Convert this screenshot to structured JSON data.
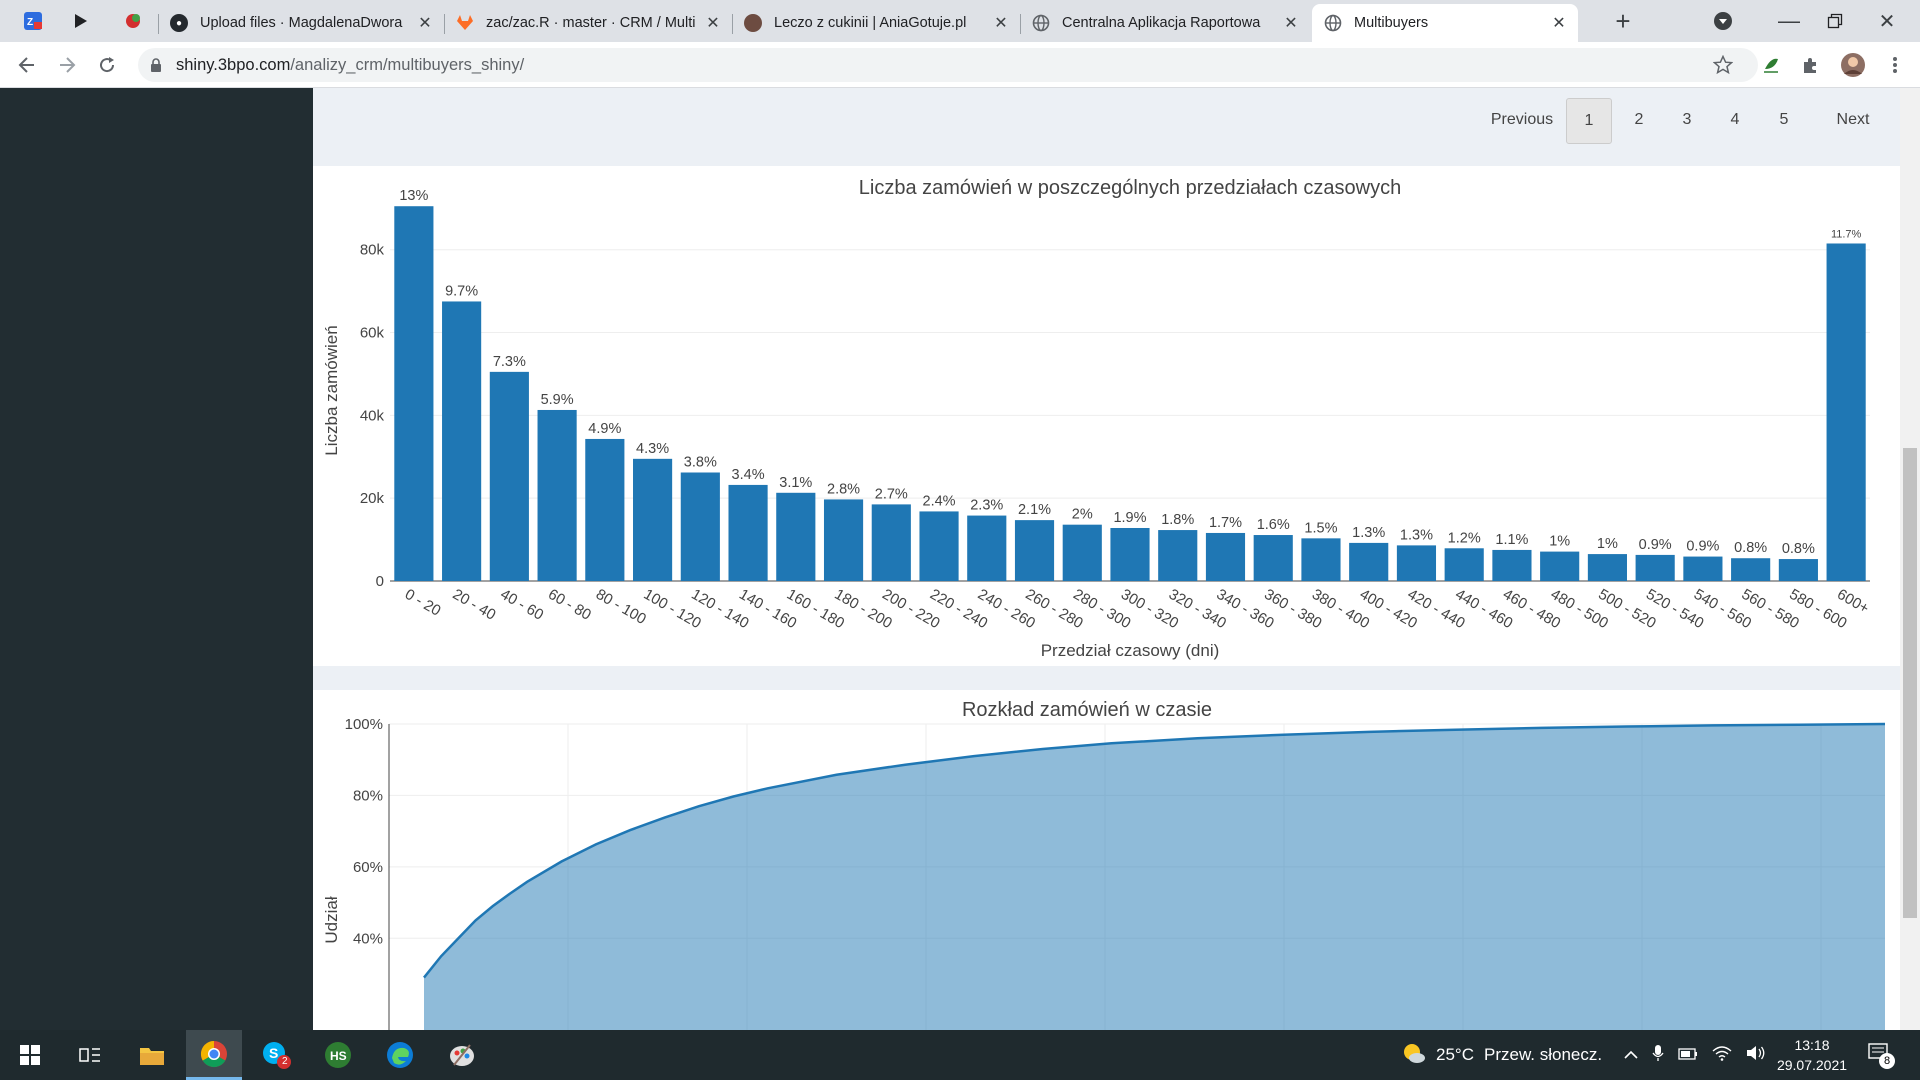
{
  "browser": {
    "tabs": [
      {
        "title": "Upload files · MagdalenaDwora",
        "favicon": "github-icon"
      },
      {
        "title": "zac/zac.R · master · CRM / Multi",
        "favicon": "gitlab-icon"
      },
      {
        "title": "Leczo z cukinii | AniaGotuje.pl",
        "favicon": "avatar-icon"
      },
      {
        "title": "Centralna Aplikacja Raportowa",
        "favicon": "globe-icon"
      },
      {
        "title": "Multibuyers",
        "favicon": "globe-icon",
        "active": true
      }
    ],
    "url_host": "shiny.3bpo.com",
    "url_path": "/analizy_crm/multibuyers_shiny/"
  },
  "pager": {
    "previous": "Previous",
    "pages": [
      "1",
      "2",
      "3",
      "4",
      "5"
    ],
    "current": "1",
    "next": "Next"
  },
  "chart_data": [
    {
      "type": "bar",
      "title": "Liczba zamówień w poszczególnych przedziałach czasowych",
      "xlabel": "Przedział czasowy (dni)",
      "ylabel": "Liczba zamówień",
      "ylim": [
        0,
        92000
      ],
      "yticks": [
        "0",
        "20k",
        "40k",
        "60k",
        "80k"
      ],
      "ytick_values": [
        0,
        20000,
        40000,
        60000,
        80000
      ],
      "grid": true,
      "color": "#1f77b4",
      "categories": [
        "0 - 20",
        "20 - 40",
        "40 - 60",
        "60 - 80",
        "80 - 100",
        "100 - 120",
        "120 - 140",
        "140 - 160",
        "160 - 180",
        "180 - 200",
        "200 - 220",
        "220 - 240",
        "240 - 260",
        "260 - 280",
        "280 - 300",
        "300 - 320",
        "320 - 340",
        "340 - 360",
        "360 - 380",
        "380 - 400",
        "400 - 420",
        "420 - 440",
        "440 - 460",
        "460 - 480",
        "480 - 500",
        "500 - 520",
        "520 - 540",
        "540 - 560",
        "560 - 580",
        "580 - 600",
        "600+"
      ],
      "values": [
        90500,
        67500,
        50500,
        41300,
        34300,
        29500,
        26200,
        23200,
        21300,
        19700,
        18500,
        16800,
        15800,
        14700,
        13600,
        12800,
        12300,
        11600,
        11100,
        10300,
        9200,
        8600,
        7900,
        7500,
        7100,
        6500,
        6300,
        5900,
        5500,
        5300,
        81500
      ],
      "labels": [
        "13%",
        "9.7%",
        "7.3%",
        "5.9%",
        "4.9%",
        "4.3%",
        "3.8%",
        "3.4%",
        "3.1%",
        "2.8%",
        "2.7%",
        "2.4%",
        "2.3%",
        "2.1%",
        "2%",
        "1.9%",
        "1.8%",
        "1.7%",
        "1.6%",
        "1.5%",
        "1.3%",
        "1.3%",
        "1.2%",
        "1.1%",
        "1%",
        "1%",
        "0.9%",
        "0.9%",
        "0.8%",
        "0.8%",
        "11.7%"
      ]
    },
    {
      "type": "area",
      "title": "Rozkład zamówień w czasie",
      "ylabel": "Udział",
      "ylim": [
        30,
        100
      ],
      "yticks": [
        "40%",
        "60%",
        "80%",
        "100%"
      ],
      "ytick_values": [
        40,
        60,
        80,
        100
      ],
      "grid": true,
      "color": "#1f77b4",
      "x": [
        0,
        10,
        20,
        30,
        40,
        50,
        60,
        80,
        100,
        120,
        140,
        160,
        180,
        200,
        240,
        280,
        320,
        360,
        400,
        450,
        500,
        550,
        600,
        650,
        700,
        750,
        800,
        850
      ],
      "y": [
        29,
        35,
        40,
        45,
        49,
        52.5,
        55.8,
        61.5,
        66.3,
        70.3,
        73.8,
        77,
        79.7,
        82,
        85.8,
        88.6,
        91,
        93,
        94.6,
        96,
        97,
        97.8,
        98.4,
        98.9,
        99.3,
        99.6,
        99.8,
        100
      ]
    }
  ],
  "taskbar": {
    "weather_temp": "25°C",
    "weather_text": "Przew. słonecz.",
    "time": "13:18",
    "date": "29.07.2021",
    "notifications": "8",
    "skype_badge": "2"
  }
}
